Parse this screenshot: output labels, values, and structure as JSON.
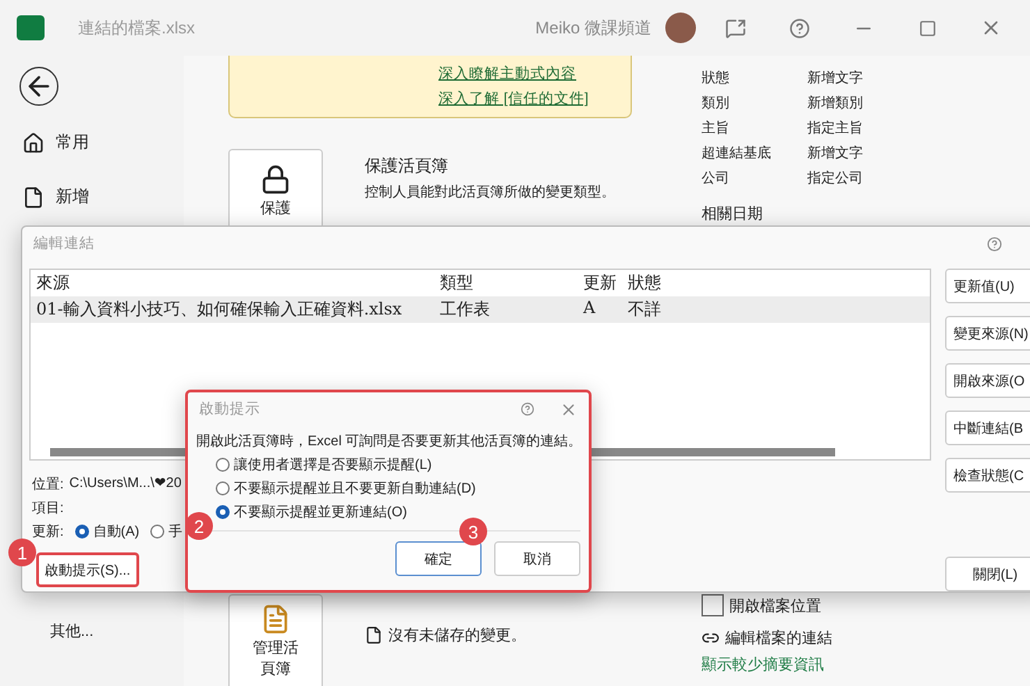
{
  "window": {
    "title": "連結的檔案.xlsx",
    "user": "Meiko 微課頻道"
  },
  "sidebar": {
    "items": [
      {
        "label": "常用"
      },
      {
        "label": "新增"
      }
    ],
    "more": "其他..."
  },
  "trust_links": [
    "深入瞭解主動式內容",
    "深入了解 [信任的文件]"
  ],
  "protect": {
    "button": "保護",
    "title": "保護活頁簿",
    "description": "控制人員能對此活頁簿所做的變更類型。"
  },
  "manage": {
    "button": "管理活頁簿",
    "status": "沒有未儲存的變更。"
  },
  "properties": [
    {
      "label": "狀態",
      "value": "新增文字"
    },
    {
      "label": "類別",
      "value": "新增類別"
    },
    {
      "label": "主旨",
      "value": "指定主旨"
    },
    {
      "label": "超連結基底",
      "value": "新增文字"
    },
    {
      "label": "公司",
      "value": "指定公司"
    }
  ],
  "related_dates": "相關日期",
  "file_links": {
    "open_location": "開啟檔案位置",
    "edit_links": "編輯檔案的連結",
    "show_less": "顯示較少摘要資訊"
  },
  "edit_links_dialog": {
    "title": "編輯連結",
    "columns": [
      "來源",
      "類型",
      "更新",
      "狀態"
    ],
    "rows": [
      {
        "cells": [
          "01-輸入資料小技巧、如何確保輸入正確資料.xlsx",
          "工作表",
          "A",
          "不詳"
        ],
        "selected": true
      }
    ],
    "buttons": [
      "更新值(U)",
      "變更來源(N)",
      "開啟來源(O",
      "中斷連結(B",
      "檢查狀態(C"
    ],
    "close": "關閉(L)",
    "location_label": "位置:",
    "location": "C:\\Users\\M...\\❤20",
    "item_label": "項目:",
    "update_label": "更新:",
    "update_options": [
      {
        "label": "自動(A)",
        "selected": true
      },
      {
        "label": "手",
        "selected": false
      }
    ],
    "startup_button": {
      "label": "啟動提示(S)...",
      "highlighted": true,
      "step": "1"
    }
  },
  "startup_dialog": {
    "title": "啟動提示",
    "highlighted": true,
    "message": "開啟此活頁簿時，Excel 可詢問是否要更新其他活頁簿的連結。",
    "options": [
      {
        "label": "讓使用者選擇是否要顯示提醒(L)",
        "selected": false
      },
      {
        "label": "不要顯示提醒並且不要更新自動連結(D)",
        "selected": false
      },
      {
        "label": "不要顯示提醒並更新連結(O)",
        "selected": true,
        "step": "2"
      }
    ],
    "ok": {
      "label": "確定",
      "step": "3"
    },
    "cancel": "取消"
  }
}
